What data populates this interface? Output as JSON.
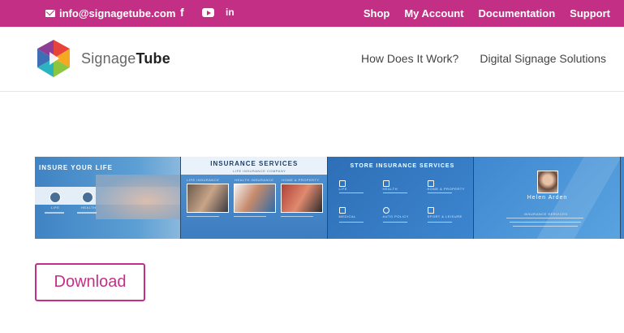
{
  "topbar": {
    "email": "info@signagetube.com",
    "social": [
      "facebook-icon",
      "youtube-icon",
      "linkedin-icon"
    ],
    "links": [
      "Shop",
      "My Account",
      "Documentation",
      "Support"
    ],
    "bg_color": "#c42f86"
  },
  "header": {
    "brand_light": "Signage",
    "brand_bold": "Tube",
    "nav": [
      "How Does It Work?",
      "Digital Signage Solutions"
    ]
  },
  "banner": {
    "panel1": {
      "title": "INSURE YOUR LIFE",
      "bubble_labels": [
        "LIFE",
        "HEALTH"
      ]
    },
    "panel2": {
      "title": "INSURANCE SERVICES",
      "subtitle": "LIFE INSURANCE COMPANY",
      "labels": [
        "LIFE INSURANCE",
        "HEALTH INSURANCE",
        "HOME & PROPERTY"
      ]
    },
    "panel3": {
      "title": "STORE INSURANCE SERVICES",
      "items": [
        "LIFE",
        "HEALTH",
        "HOME & PROPERTY",
        "MEDICAL",
        "AUTO POLICY",
        "SPORT & LEISURE"
      ]
    },
    "panel4": {
      "name": "Helen Arden",
      "role": "INSURANCE SERVICES"
    }
  },
  "download": {
    "label": "Download"
  }
}
